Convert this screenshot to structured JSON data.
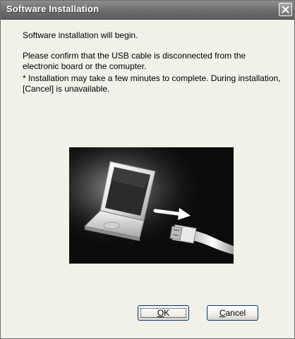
{
  "window": {
    "title": "Software Installation"
  },
  "message": {
    "line1": "Software installation will begin.",
    "line2": "Please confirm that the USB cable is disconnected from the electronic board or the comupter.",
    "line3": "* Installation may take a few minutes to complete. During installation, [Cancel] is unavailable."
  },
  "illustration": {
    "icons": [
      "laptop-icon",
      "arrow-right-icon",
      "usb-plug-icon"
    ]
  },
  "buttons": {
    "ok": {
      "mnemonic": "O",
      "rest": "K"
    },
    "cancel": {
      "mnemonic": "C",
      "rest": "ancel"
    }
  },
  "colors": {
    "titlebar": "#6c6c6c",
    "body": "#f1f0e9",
    "button_border": "#003c74",
    "illustration_bg": "#0b0b0b"
  }
}
